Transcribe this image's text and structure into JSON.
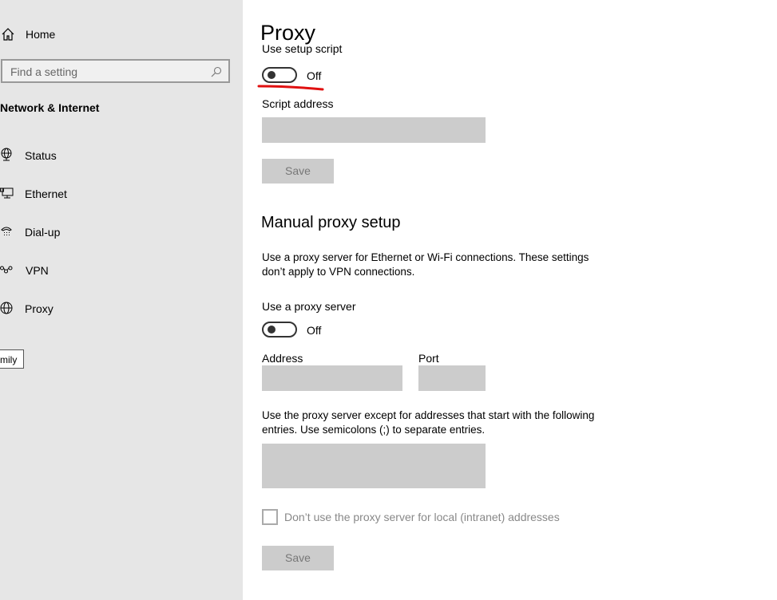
{
  "sidebar": {
    "home": "Home",
    "search_placeholder": "Find a setting",
    "section": "Network & Internet",
    "items": [
      {
        "label": "Status",
        "icon": "globe-monitor-icon"
      },
      {
        "label": "Ethernet",
        "icon": "ethernet-icon"
      },
      {
        "label": "Dial-up",
        "icon": "phone-icon"
      },
      {
        "label": "VPN",
        "icon": "vpn-icon"
      },
      {
        "label": "Proxy",
        "icon": "globe-icon"
      }
    ],
    "tooltip": "mily"
  },
  "main": {
    "title": "Proxy",
    "setup_script_label": "Use setup script",
    "setup_script_state": "Off",
    "script_address_label": "Script address",
    "script_address_value": "",
    "save_label": "Save",
    "manual_heading": "Manual proxy setup",
    "manual_desc": "Use a proxy server for Ethernet or Wi-Fi connections. These settings don’t apply to VPN connections.",
    "use_proxy_label": "Use a proxy server",
    "use_proxy_state": "Off",
    "address_label": "Address",
    "port_label": "Port",
    "exceptions_desc": "Use the proxy server except for addresses that start with the following entries. Use semicolons (;) to separate entries.",
    "local_checkbox_label": "Don’t use the proxy server for local (intranet) addresses",
    "save2_label": "Save"
  },
  "colors": {
    "annotation": "#e01010",
    "sidebar_bg": "#e6e6e6",
    "field_bg": "#cccccc"
  }
}
